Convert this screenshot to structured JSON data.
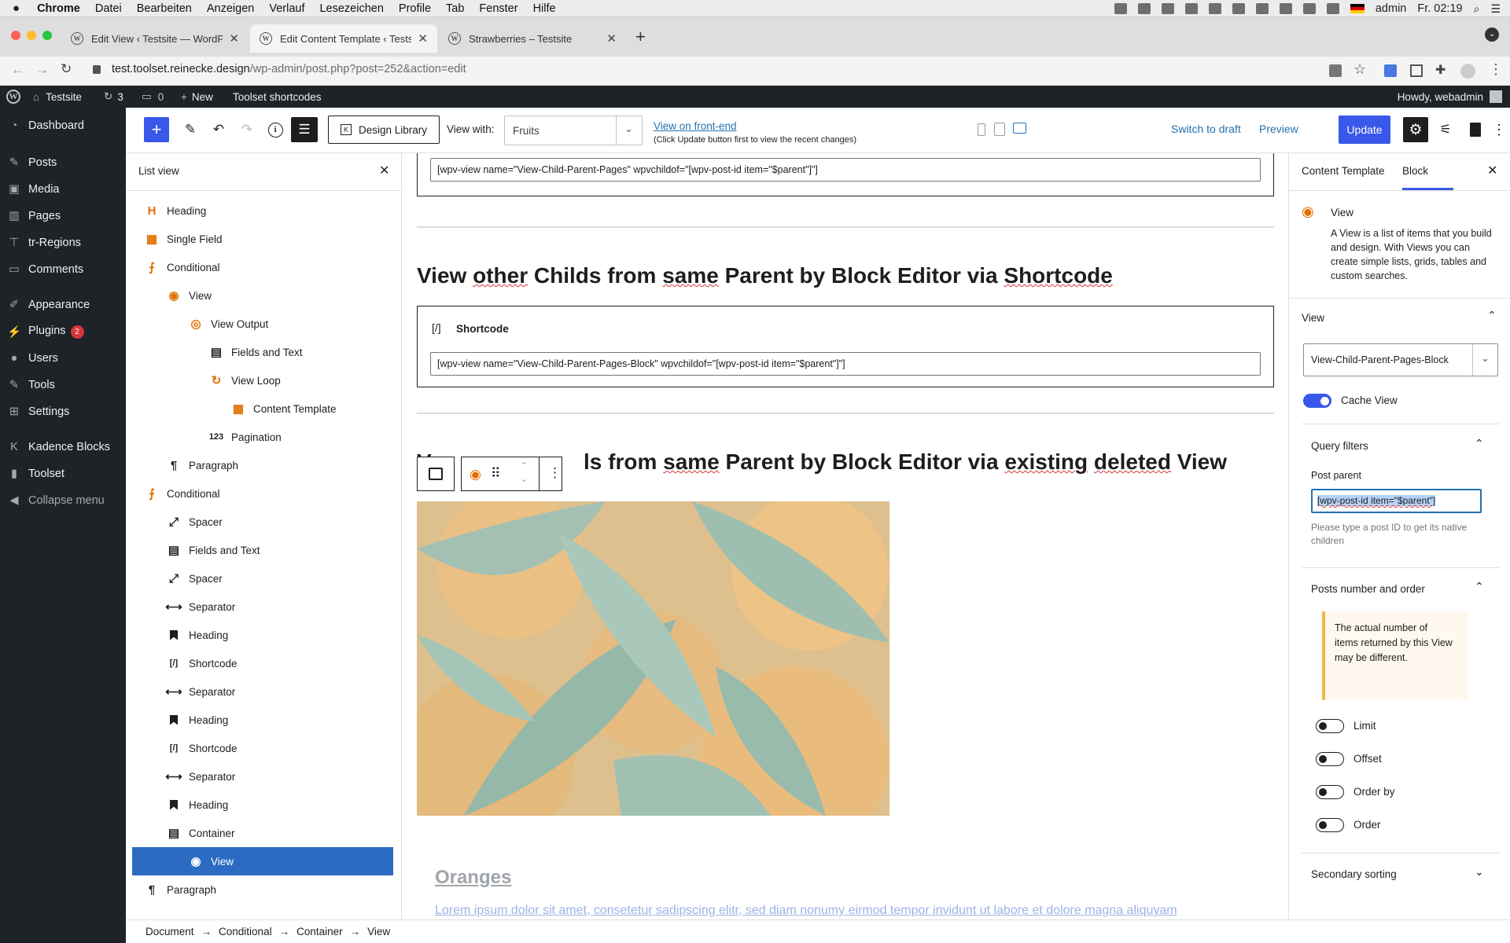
{
  "mac_menu": {
    "app": "Chrome",
    "items": [
      "Datei",
      "Bearbeiten",
      "Anzeigen",
      "Verlauf",
      "Lesezeichen",
      "Profile",
      "Tab",
      "Fenster",
      "Hilfe"
    ],
    "user": "admin",
    "clock": "Fr. 02:19"
  },
  "browser": {
    "tabs": [
      {
        "title": "Edit View ‹ Testsite — WordPress"
      },
      {
        "title": "Edit Content Template ‹ Testsite"
      },
      {
        "title": "Strawberries – Testsite"
      }
    ],
    "url_host": "test.toolset.reinecke.design",
    "url_path": "/wp-admin/post.php?post=252&action=edit"
  },
  "admin_bar": {
    "site_name": "Testsite",
    "updates_count": "3",
    "comments_count": "0",
    "new_label": "New",
    "toolset_label": "Toolset shortcodes",
    "howdy": "Howdy, webadmin"
  },
  "admin_menu": [
    {
      "label": "Dashboard",
      "icon": "dashboard-icon"
    },
    {
      "label": "Posts",
      "icon": "pin-icon"
    },
    {
      "label": "Media",
      "icon": "media-icon"
    },
    {
      "label": "Pages",
      "icon": "pages-icon"
    },
    {
      "label": "tr-Regions",
      "icon": "hierarchy-icon"
    },
    {
      "label": "Comments",
      "icon": "comments-icon"
    },
    {
      "label": "Appearance",
      "icon": "brush-icon"
    },
    {
      "label": "Plugins",
      "icon": "plug-icon",
      "badge": "2"
    },
    {
      "label": "Users",
      "icon": "users-icon"
    },
    {
      "label": "Tools",
      "icon": "wrench-icon"
    },
    {
      "label": "Settings",
      "icon": "settings-icon"
    },
    {
      "label": "Kadence Blocks",
      "icon": "kadence-icon"
    },
    {
      "label": "Toolset",
      "icon": "toolset-icon"
    },
    {
      "label": "Collapse menu",
      "icon": "collapse-icon"
    }
  ],
  "editor_header": {
    "design_library": "Design Library",
    "view_with_label": "View with:",
    "view_with_value": "Fruits",
    "front_end_link": "View on front-end",
    "front_end_note": "(Click Update button first to view the recent changes)",
    "switch_to_draft": "Switch to draft",
    "preview": "Preview",
    "update": "Update"
  },
  "list_view": {
    "title": "List view",
    "items": [
      {
        "label": "Heading",
        "icon": "H",
        "kind": "heading-h-icon",
        "depth": 0
      },
      {
        "label": "Single Field",
        "icon": "▦",
        "kind": "single-field-icon",
        "depth": 0
      },
      {
        "label": "Conditional",
        "icon": "⨍",
        "kind": "conditional-icon",
        "depth": 0
      },
      {
        "label": "View",
        "icon": "◉",
        "kind": "view-icon",
        "depth": 1
      },
      {
        "label": "View Output",
        "icon": "◎",
        "kind": "view-output-icon",
        "depth": 2
      },
      {
        "label": "Fields and Text",
        "icon": "▤",
        "kind": "fields-text-icon",
        "depth": 3
      },
      {
        "label": "View Loop",
        "icon": "↻",
        "kind": "view-loop-icon",
        "depth": 3
      },
      {
        "label": "Content Template",
        "icon": "▦",
        "kind": "content-template-icon",
        "depth": 4
      },
      {
        "label": "Pagination",
        "icon": "123",
        "kind": "pagination-icon",
        "depth": 3
      },
      {
        "label": "Paragraph",
        "icon": "¶",
        "kind": "paragraph-icon",
        "depth": 1
      },
      {
        "label": "Conditional",
        "icon": "⨍",
        "kind": "conditional-icon",
        "depth": 0
      },
      {
        "label": "Spacer",
        "icon": "⤢",
        "kind": "spacer-icon",
        "depth": 1
      },
      {
        "label": "Fields and Text",
        "icon": "▤",
        "kind": "fields-text-icon",
        "depth": 1
      },
      {
        "label": "Spacer",
        "icon": "⤢",
        "kind": "spacer-icon",
        "depth": 1
      },
      {
        "label": "Separator",
        "icon": "⟷",
        "kind": "separator-icon",
        "depth": 1
      },
      {
        "label": "Heading",
        "icon": "🔖",
        "kind": "heading-bookmark-icon",
        "depth": 1
      },
      {
        "label": "Shortcode",
        "icon": "[/]",
        "kind": "shortcode-icon",
        "depth": 1
      },
      {
        "label": "Separator",
        "icon": "⟷",
        "kind": "separator-icon",
        "depth": 1
      },
      {
        "label": "Heading",
        "icon": "🔖",
        "kind": "heading-bookmark-icon",
        "depth": 1
      },
      {
        "label": "Shortcode",
        "icon": "[/]",
        "kind": "shortcode-icon",
        "depth": 1
      },
      {
        "label": "Separator",
        "icon": "⟷",
        "kind": "separator-icon",
        "depth": 1
      },
      {
        "label": "Heading",
        "icon": "🔖",
        "kind": "heading-bookmark-icon",
        "depth": 1
      },
      {
        "label": "Container",
        "icon": "▤",
        "kind": "container-icon",
        "depth": 1
      },
      {
        "label": "View",
        "icon": "◉",
        "kind": "view-icon",
        "depth": 2,
        "selected": true
      },
      {
        "label": "Paragraph",
        "icon": "¶",
        "kind": "paragraph-icon",
        "depth": 0
      }
    ]
  },
  "canvas": {
    "shortcode_top": "[wpv-view name=\"View-Child-Parent-Pages\" wpvchildof=\"[wpv-post-id item=\"$parent\"]\"]",
    "heading_1_parts": [
      "View ",
      "other",
      " Childs from ",
      "same",
      " Parent by Block Editor via ",
      "Shortcode"
    ],
    "shortcode_block_label": "Shortcode",
    "shortcode_mid": "[wpv-view name=\"View-Child-Parent-Pages-Block\" wpvchildof=\"[wpv-post-id item=\"$parent\"]\"]",
    "heading_2_parts": [
      "ls from ",
      "same",
      " Parent by Block Editor via ",
      "existing",
      " ",
      "deleted",
      " View"
    ],
    "heading_2_lead": "V",
    "image_alt": "Oranges with leaves",
    "post_title": "Oranges",
    "post_excerpt": "Lorem ipsum dolor sit amet, consetetur sadipscing elitr, sed diam nonumy eirmod tempor invidunt ut labore et dolore magna aliquyam"
  },
  "settings": {
    "tab_content_template": "Content Template",
    "tab_block": "Block",
    "block_name": "View",
    "block_desc": "A View is a list of items that you build and design. With Views you can create simple lists, grids, tables and custom searches.",
    "view_section": "View",
    "view_select": "View-Child-Parent-Pages-Block",
    "cache_view": "Cache View",
    "cache_view_on": true,
    "query_filters": "Query filters",
    "post_parent_label": "Post parent",
    "post_parent_value": "[wpv-post-id item=\"$parent\"]",
    "post_parent_help": "Please type a post ID to get its native children",
    "posts_number_order": "Posts number and order",
    "notice": "The actual number of items returned by this View may be different.",
    "toggles": [
      {
        "label": "Limit",
        "on": false
      },
      {
        "label": "Offset",
        "on": false
      },
      {
        "label": "Order by",
        "on": false
      },
      {
        "label": "Order",
        "on": false
      }
    ],
    "secondary_sorting": "Secondary sorting"
  },
  "breadcrumb": [
    "Document",
    "Conditional",
    "Container",
    "View"
  ],
  "colors": {
    "wp_dark": "#1d2327",
    "accent_blue": "#3858e9",
    "toolset_orange": "#e26f00",
    "selected_row": "#2c6bc2"
  }
}
